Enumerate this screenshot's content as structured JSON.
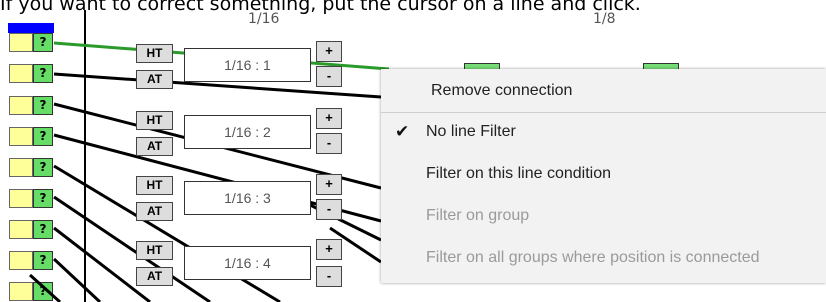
{
  "instructions": "If you want to correct something, put the cursor on a line and click.",
  "rounds": [
    {
      "label": "1/16"
    },
    {
      "label": "1/8"
    }
  ],
  "left_column": {
    "question_label": "?"
  },
  "matches": [
    {
      "home_label": "HT",
      "away_label": "AT",
      "name": "1/16 : 1",
      "plus": "+",
      "minus": "-"
    },
    {
      "home_label": "HT",
      "away_label": "AT",
      "name": "1/16 : 2",
      "plus": "+",
      "minus": "-"
    },
    {
      "home_label": "HT",
      "away_label": "AT",
      "name": "1/16 : 3",
      "plus": "+",
      "minus": "-"
    },
    {
      "home_label": "HT",
      "away_label": "AT",
      "name": "1/16 : 4",
      "plus": "+",
      "minus": "-"
    }
  ],
  "colors": {
    "highlight_line": "#2a9a2a",
    "line": "#000000",
    "top_bar": "#0000ff",
    "question_fill": "#66dd66",
    "yellow_fill": "#ffff99"
  },
  "context_menu": {
    "items": [
      {
        "label": "Remove connection",
        "enabled": true,
        "checked": false
      },
      {
        "label": "No line Filter",
        "enabled": true,
        "checked": true
      },
      {
        "label": "Filter on this line condition",
        "enabled": true,
        "checked": false
      },
      {
        "label": "Filter on group",
        "enabled": false,
        "checked": false
      },
      {
        "label": "Filter on all groups where position is connected",
        "enabled": false,
        "checked": false
      }
    ],
    "check_icon": "checkmark-icon"
  }
}
